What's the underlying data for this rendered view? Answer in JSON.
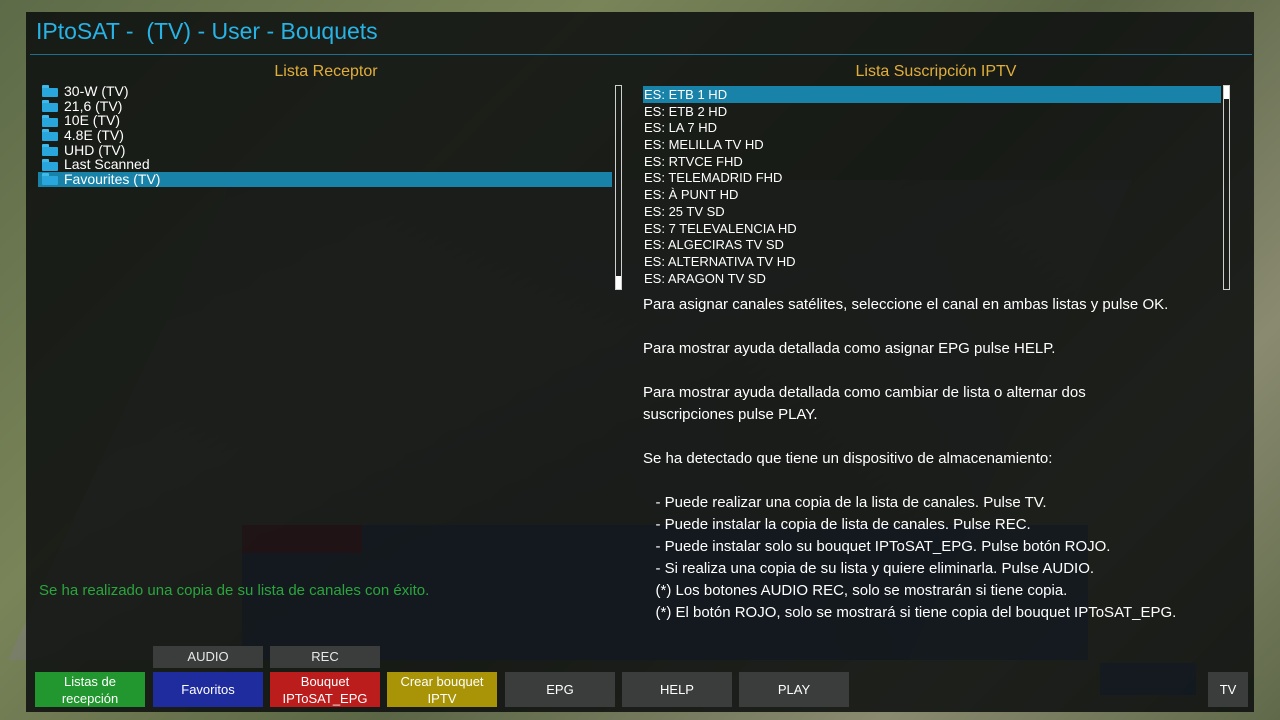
{
  "window": {
    "title": "IPtoSAT -  (TV) - User - Bouquets"
  },
  "receptor": {
    "heading": "Lista Receptor",
    "items": [
      {
        "label": "30-W (TV)"
      },
      {
        "label": "21,6 (TV)"
      },
      {
        "label": "10E (TV)"
      },
      {
        "label": "4.8E (TV)"
      },
      {
        "label": "UHD (TV)"
      },
      {
        "label": "Last Scanned"
      },
      {
        "label": "Favourites (TV)"
      }
    ],
    "selected_index": 6,
    "icon": "folder-icon"
  },
  "iptv": {
    "heading": "Lista Suscripción IPTV",
    "items": [
      {
        "label": "ES: ETB 1 HD"
      },
      {
        "label": "ES: ETB 2 HD"
      },
      {
        "label": "ES: LA 7 HD"
      },
      {
        "label": "ES: MELILLA TV HD"
      },
      {
        "label": "ES: RTVCE FHD"
      },
      {
        "label": "ES: TELEMADRID FHD"
      },
      {
        "label": "ES: À PUNT HD"
      },
      {
        "label": "ES: 25 TV SD"
      },
      {
        "label": "ES: 7 TELEVALENCIA HD"
      },
      {
        "label": "ES: ALGECIRAS TV SD"
      },
      {
        "label": "ES: ALTERNATIVA TV HD"
      },
      {
        "label": "ES: ARAGON TV SD"
      }
    ],
    "selected_index": 0
  },
  "help": {
    "lines": [
      "Para asignar canales satélites, seleccione el canal en ambas listas y pulse OK.",
      "",
      "Para mostrar ayuda detallada como asignar EPG pulse HELP.",
      "",
      "Para mostrar ayuda detallada como cambiar de lista o alternar dos",
      "suscripciones pulse PLAY.",
      "",
      "Se ha detectado que tiene un dispositivo de almacenamiento:",
      "",
      "   - Puede realizar una copia de la lista de canales. Pulse TV.",
      "   - Puede instalar la copia de lista de canales. Pulse REC.",
      "   - Puede instalar solo su bouquet IPToSAT_EPG. Pulse botón ROJO.",
      "   - Si realiza una copia de su lista y quiere eliminarla. Pulse AUDIO.",
      "   (*) Los botones AUDIO REC, solo se mostrarán si tiene copia.",
      "   (*) El botón ROJO, solo se mostrará si tiene copia del bouquet IPToSAT_EPG."
    ]
  },
  "status": {
    "message": "Se ha realizado una copia de su lista de canales con éxito."
  },
  "keys": {
    "audio": "AUDIO",
    "rec": "REC",
    "green": "Listas de recepción",
    "blue": "Favoritos",
    "red": "Bouquet IPToSAT_EPG",
    "yellow": "Crear bouquet IPTV",
    "epg": "EPG",
    "help": "HELP",
    "play": "PLAY",
    "tv": "TV"
  },
  "colors": {
    "accent": "#27b3e6",
    "heading": "#e2ae3b",
    "selection": "#1882a9",
    "status": "#2aa63d",
    "green": "#22972f",
    "blue": "#1f2c9d",
    "red": "#bb1c1c",
    "yellow": "#a89406"
  }
}
